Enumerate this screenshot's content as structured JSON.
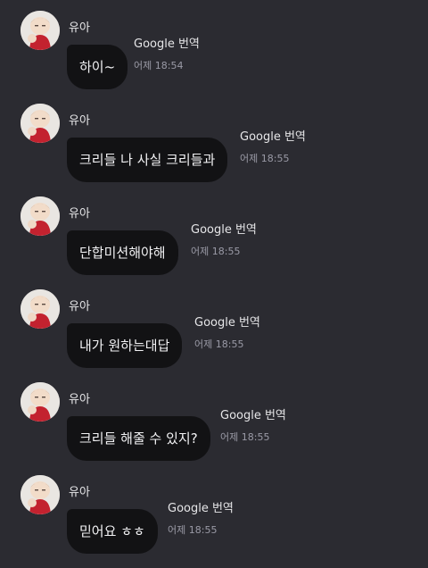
{
  "chat": {
    "messages": [
      {
        "sender": "유아",
        "text": "하이~",
        "translate_label": "Google 번역",
        "time": "어제 18:54"
      },
      {
        "sender": "유아",
        "text": "크리들 나 사실 크리들과",
        "translate_label": "Google 번역",
        "time": "어제 18:55"
      },
      {
        "sender": "유아",
        "text": "단합미션해야해",
        "translate_label": "Google 번역",
        "time": "어제 18:55"
      },
      {
        "sender": "유아",
        "text": "내가 원하는대답",
        "translate_label": "Google 번역",
        "time": "어제 18:55"
      },
      {
        "sender": "유아",
        "text": "크리들 해줄 수 있지?",
        "translate_label": "Google 번역",
        "time": "어제 18:55"
      },
      {
        "sender": "유아",
        "text": "믿어요 ㅎㅎ",
        "translate_label": "Google 번역",
        "time": "어제 18:55"
      }
    ]
  },
  "colors": {
    "background": "#2b2b31",
    "bubble": "#121214",
    "timestamp": "#9a9aa6"
  }
}
